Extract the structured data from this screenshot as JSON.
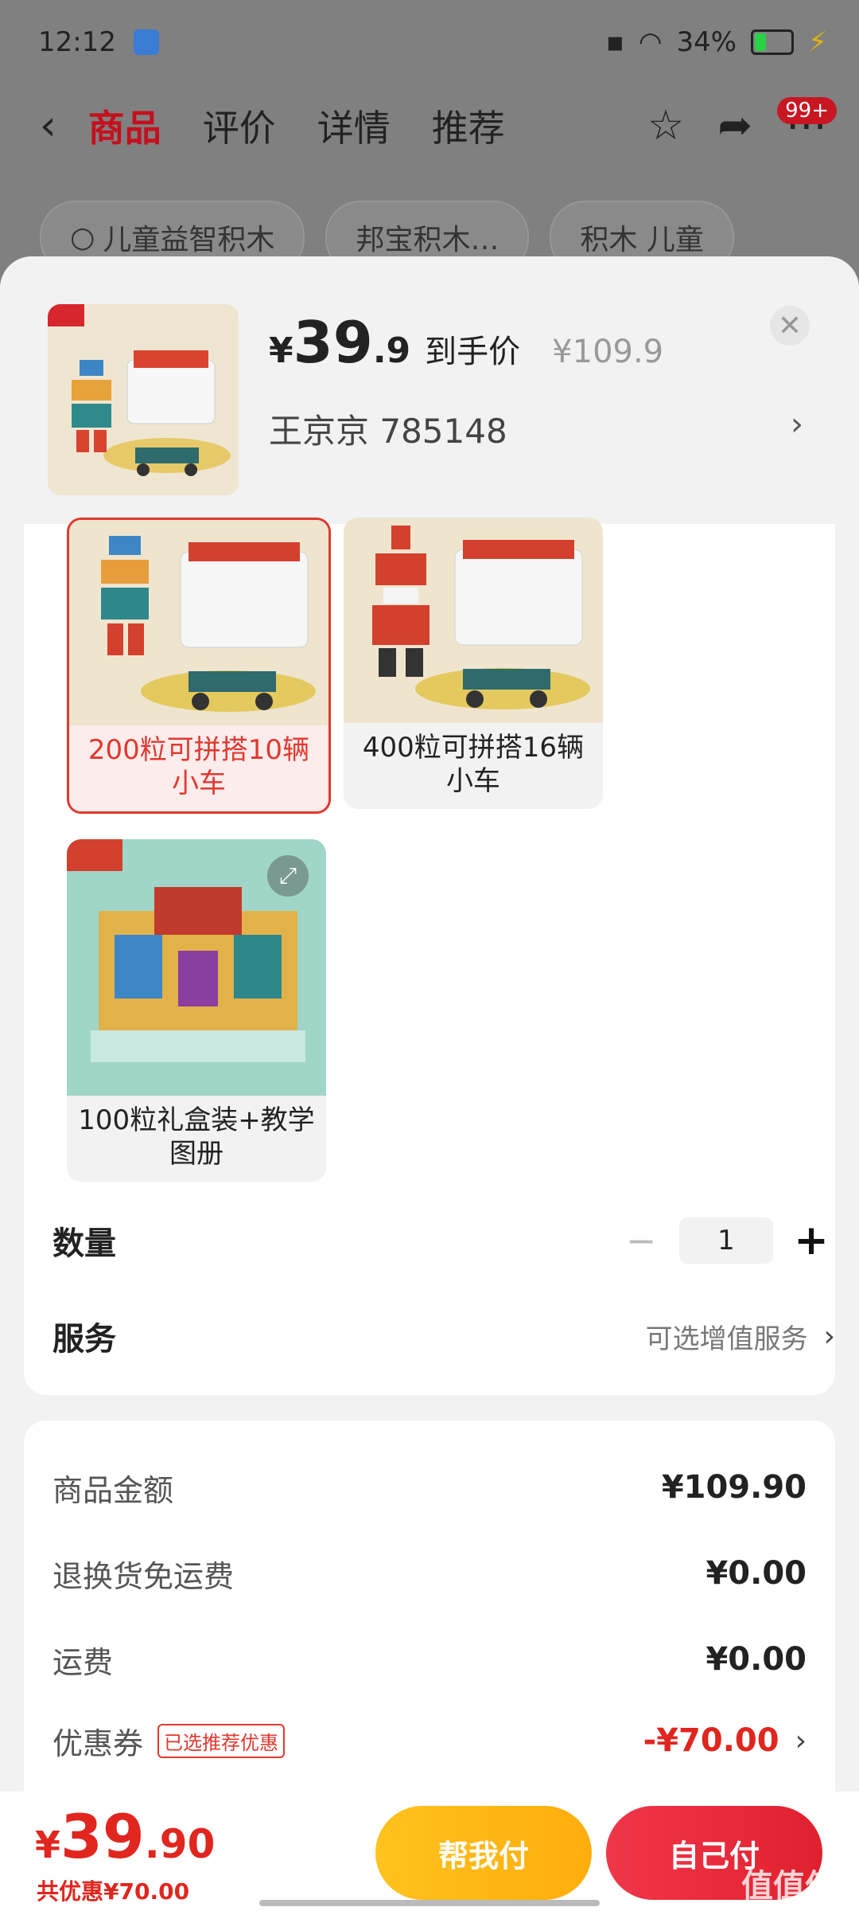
{
  "status": {
    "time": "12:12",
    "battery": "34%"
  },
  "nav": {
    "tabs": [
      "商品",
      "评价",
      "详情",
      "推荐"
    ],
    "badge": "99+"
  },
  "search_chips": [
    "儿童益智积木",
    "邦宝积木…",
    "积木 儿童"
  ],
  "sheet": {
    "price_symbol": "¥",
    "price_int": "39",
    "price_dec": ".9",
    "price_label": "到手价",
    "orig_price": "¥109.9",
    "address": "王京京  785148",
    "options": [
      {
        "label": "200粒可拼搭10辆小车",
        "selected": true
      },
      {
        "label": "400粒可拼搭16辆小车",
        "selected": false
      },
      {
        "label": "100粒礼盒装+教学图册",
        "selected": false
      }
    ],
    "quantity_label": "数量",
    "quantity": "1",
    "service_label": "服务",
    "service_hint": "可选增值服务"
  },
  "fees": {
    "goods_label": "商品金额",
    "goods_value": "¥109.90",
    "return_label": "退换货免运费",
    "return_value": "¥0.00",
    "ship_label": "运费",
    "ship_value": "¥0.00",
    "coupon_label": "优惠券",
    "coupon_tag": "已选推荐优惠",
    "coupon_value": "-¥70.00"
  },
  "footer": {
    "total_symbol": "¥",
    "total_int": "39",
    "total_dec": ".90",
    "discount": "共优惠¥70.00",
    "help_pay": "帮我付",
    "self_pay": "自己付",
    "watermark": "值值值"
  },
  "colors": {
    "accent": "#e0392f",
    "yellow": "#ffb818",
    "red": "#e8283a"
  }
}
